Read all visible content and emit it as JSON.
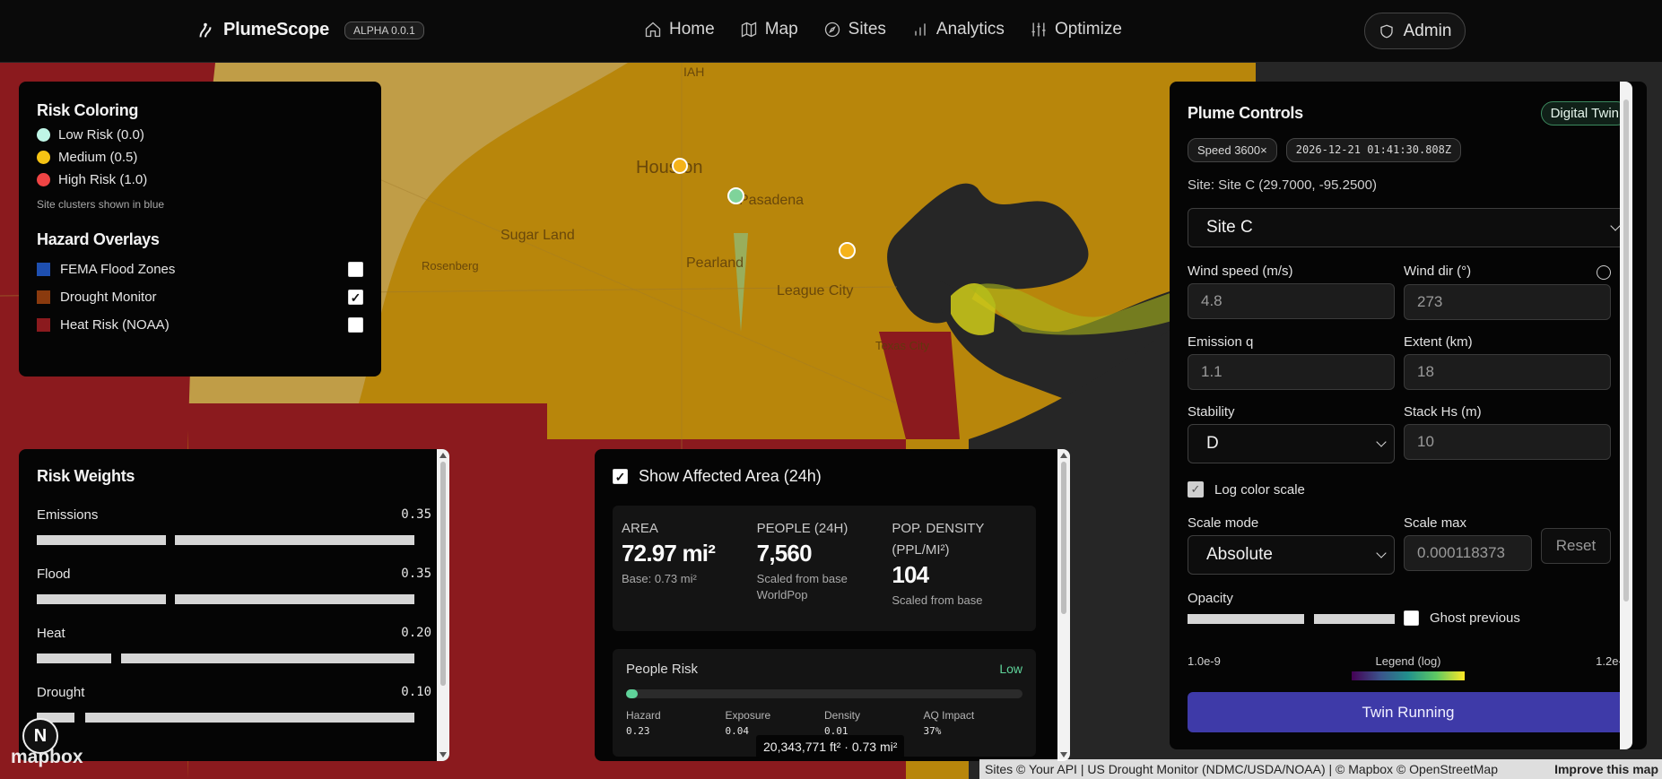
{
  "header": {
    "brand": "PlumeScope",
    "version": "ALPHA 0.0.1",
    "nav": [
      {
        "label": "Home",
        "icon": "home-icon"
      },
      {
        "label": "Map",
        "icon": "map-icon"
      },
      {
        "label": "Sites",
        "icon": "compass-icon"
      },
      {
        "label": "Analytics",
        "icon": "bar-chart-icon"
      },
      {
        "label": "Optimize",
        "icon": "sliders-icon"
      }
    ],
    "admin": "Admin"
  },
  "map": {
    "labels": [
      "IAH",
      "Houston",
      "Pasadena",
      "Sugar Land",
      "Rosenberg",
      "Pearland",
      "League City",
      "Texas City"
    ]
  },
  "risk_coloring": {
    "title": "Risk Coloring",
    "items": [
      {
        "label": "Low Risk (0.0)",
        "color": "#bff5e6"
      },
      {
        "label": "Medium (0.5)",
        "color": "#f5c314"
      },
      {
        "label": "High Risk (1.0)",
        "color": "#ef4444"
      }
    ],
    "hint": "Site clusters shown in blue"
  },
  "hazard_overlays": {
    "title": "Hazard Overlays",
    "items": [
      {
        "label": "FEMA Flood Zones",
        "color": "#1e4fb0",
        "checked": false
      },
      {
        "label": "Drought Monitor",
        "color": "#8a3a0e",
        "checked": true
      },
      {
        "label": "Heat Risk (NOAA)",
        "color": "#8b1a1e",
        "checked": false
      }
    ]
  },
  "risk_weights": {
    "title": "Risk Weights",
    "items": [
      {
        "label": "Emissions",
        "value": "0.35"
      },
      {
        "label": "Flood",
        "value": "0.35"
      },
      {
        "label": "Heat",
        "value": "0.20"
      },
      {
        "label": "Drought",
        "value": "0.10"
      }
    ]
  },
  "affected": {
    "toggle_label": "Show Affected Area (24h)",
    "area_label": "AREA",
    "area_value": "72.97 mi²",
    "area_sub": "Base: 0.73 mi²",
    "people_label": "PEOPLE (24H)",
    "people_value": "7,560",
    "people_sub": "Scaled from base WorldPop",
    "density_label": "POP. DENSITY (PPL/MI²)",
    "density_value": "104",
    "density_sub": "Scaled from base",
    "people_risk_title": "People Risk",
    "people_risk_level": "Low",
    "people_risk_fraction": 0.03,
    "metrics": [
      {
        "label": "Hazard",
        "value": "0.23"
      },
      {
        "label": "Exposure",
        "value": "0.04"
      },
      {
        "label": "Density",
        "value": "0.01"
      },
      {
        "label": "AQ Impact",
        "value": "37%"
      }
    ]
  },
  "scale_tip": "20,343,771 ft² · 0.73 mi²",
  "plume": {
    "title": "Plume Controls",
    "badge": "Digital Twin",
    "speed_chip": "Speed 3600×",
    "time_chip": "2026-12-21 01:41:30.808Z",
    "site_line": "Site: Site C (29.7000, -95.2500)",
    "site_select": "Site C",
    "wind_speed_label": "Wind speed (m/s)",
    "wind_speed": "4.8",
    "wind_dir_label": "Wind dir (°)",
    "wind_dir": "273",
    "emission_label": "Emission q",
    "emission": "1.1",
    "extent_label": "Extent (km)",
    "extent": "18",
    "stability_label": "Stability",
    "stability": "D",
    "stack_label": "Stack Hs (m)",
    "stack": "10",
    "log_label": "Log color scale",
    "scale_mode_label": "Scale mode",
    "scale_mode": "Absolute",
    "scale_max_label": "Scale max",
    "scale_max": "0.000118373",
    "reset": "Reset",
    "opacity_label": "Opacity",
    "ghost_label": "Ghost previous",
    "legend_min": "1.0e-9",
    "legend_title": "Legend (log)",
    "legend_max": "1.2e-4",
    "run_button": "Twin Running"
  },
  "map_logo": "mapbox",
  "attribution": "Sites © Your API | US Drought Monitor (NDMC/USDA/NOAA) | © Mapbox © OpenStreetMap",
  "attribution_link": "Improve this map"
}
